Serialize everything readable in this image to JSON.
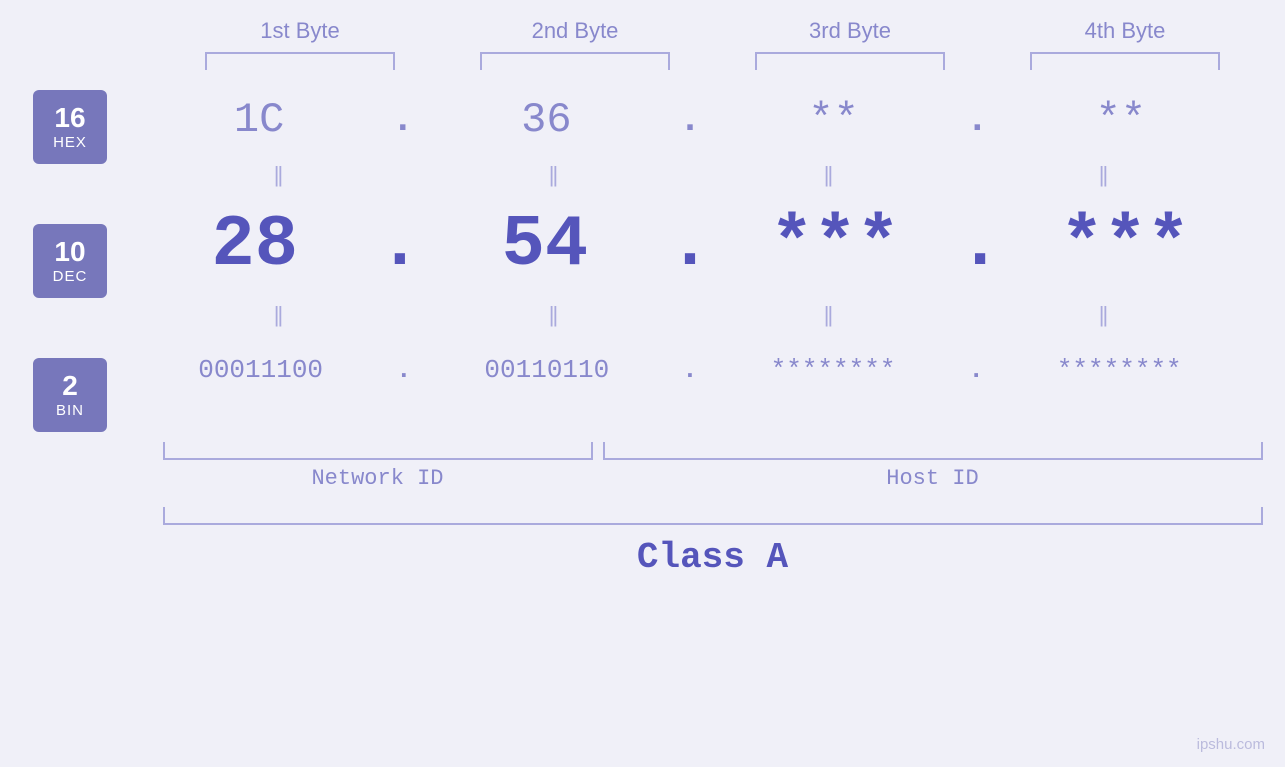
{
  "headers": {
    "byte1": "1st Byte",
    "byte2": "2nd Byte",
    "byte3": "3rd Byte",
    "byte4": "4th Byte"
  },
  "bases": [
    {
      "num": "16",
      "name": "HEX"
    },
    {
      "num": "10",
      "name": "DEC"
    },
    {
      "num": "2",
      "name": "BIN"
    }
  ],
  "rows": {
    "hex": {
      "b1": "1C",
      "b2": "36",
      "b3": "**",
      "b4": "**"
    },
    "dec": {
      "b1": "28",
      "b2": "54",
      "b3": "***",
      "b4": "***"
    },
    "bin": {
      "b1": "00011100",
      "b2": "00110110",
      "b3": "********",
      "b4": "********"
    }
  },
  "labels": {
    "network_id": "Network ID",
    "host_id": "Host ID",
    "class": "Class A"
  },
  "watermark": "ipshu.com"
}
